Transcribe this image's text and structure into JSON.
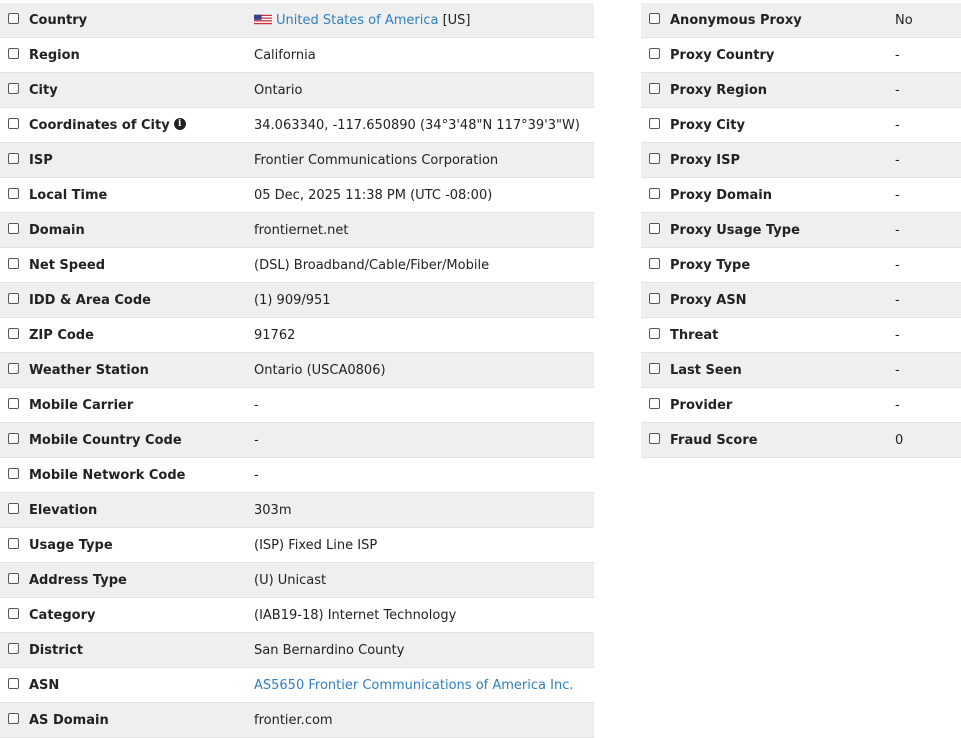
{
  "left_rows": [
    {
      "label": "Country",
      "value": "",
      "link": "United States of America",
      "suffix": " [US]",
      "flag": "us-flag-icon"
    },
    {
      "label": "Region",
      "value": "California"
    },
    {
      "label": "City",
      "value": "Ontario"
    },
    {
      "label": "Coordinates of City",
      "value": "34.063340, -117.650890 (34°3'48\"N   117°39'3\"W)",
      "info": "i"
    },
    {
      "label": "ISP",
      "value": "Frontier Communications Corporation"
    },
    {
      "label": "Local Time",
      "value": "05 Dec, 2025 11:38 PM (UTC -08:00)"
    },
    {
      "label": "Domain",
      "value": "frontiernet.net"
    },
    {
      "label": "Net Speed",
      "value": "(DSL) Broadband/Cable/Fiber/Mobile"
    },
    {
      "label": "IDD & Area Code",
      "value": "(1) 909/951"
    },
    {
      "label": "ZIP Code",
      "value": "91762"
    },
    {
      "label": "Weather Station",
      "value": "Ontario (USCA0806)"
    },
    {
      "label": "Mobile Carrier",
      "value": "-"
    },
    {
      "label": "Mobile Country Code",
      "value": "-"
    },
    {
      "label": "Mobile Network Code",
      "value": "-"
    },
    {
      "label": "Elevation",
      "value": "303m"
    },
    {
      "label": "Usage Type",
      "value": "(ISP) Fixed Line ISP"
    },
    {
      "label": "Address Type",
      "value": "(U) Unicast"
    },
    {
      "label": "Category",
      "value": "(IAB19-18) Internet Technology"
    },
    {
      "label": "District",
      "value": "San Bernardino County"
    },
    {
      "label": "ASN",
      "value": "",
      "link": "AS5650 Frontier Communications of America Inc."
    },
    {
      "label": "AS Domain",
      "value": "frontier.com"
    }
  ],
  "right_rows": [
    {
      "label": "Anonymous Proxy",
      "value": "No"
    },
    {
      "label": "Proxy Country",
      "value": "-"
    },
    {
      "label": "Proxy Region",
      "value": "-"
    },
    {
      "label": "Proxy City",
      "value": "-"
    },
    {
      "label": "Proxy ISP",
      "value": "-"
    },
    {
      "label": "Proxy Domain",
      "value": "-"
    },
    {
      "label": "Proxy Usage Type",
      "value": "-"
    },
    {
      "label": "Proxy Type",
      "value": "-"
    },
    {
      "label": "Proxy ASN",
      "value": "-"
    },
    {
      "label": "Threat",
      "value": "-"
    },
    {
      "label": "Last Seen",
      "value": "-"
    },
    {
      "label": "Provider",
      "value": "-"
    },
    {
      "label": "Fraud Score",
      "value": "0"
    }
  ],
  "colors": {
    "link": "#2f7fc1",
    "alt_row": "#efefef",
    "border": "#e2e2e2"
  }
}
